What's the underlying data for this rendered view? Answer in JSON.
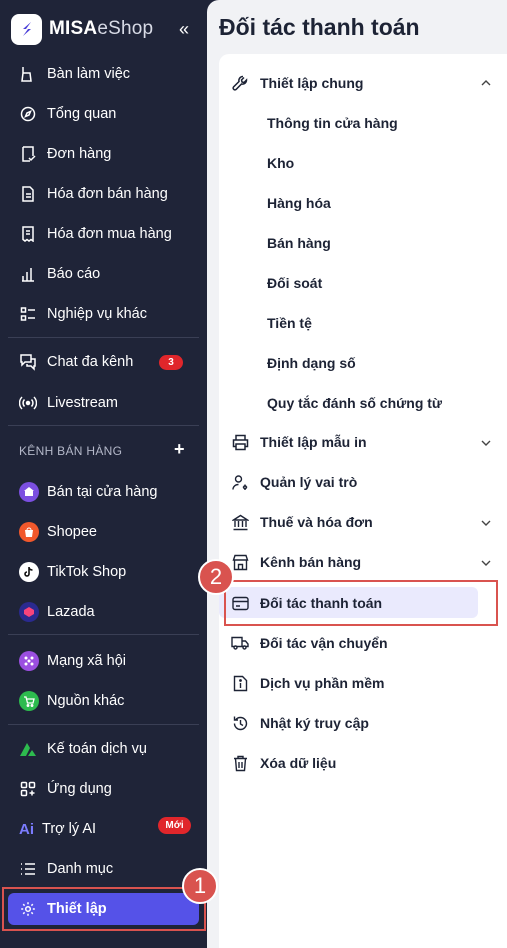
{
  "app": {
    "logo_bold": "MISA",
    "logo_light": "eShop",
    "collapse_icon": "«"
  },
  "sidebar": {
    "items": [
      {
        "label": "Bàn làm việc",
        "icon": "broom-icon"
      },
      {
        "label": "Tổng quan",
        "icon": "compass-icon"
      },
      {
        "label": "Đơn hàng",
        "icon": "order-icon"
      },
      {
        "label": "Hóa đơn bán hàng",
        "icon": "invoice-icon"
      },
      {
        "label": "Hóa đơn mua hàng",
        "icon": "receipt-icon"
      },
      {
        "label": "Báo cáo",
        "icon": "bar-chart-icon"
      },
      {
        "label": "Nghiệp vụ khác",
        "icon": "checklist-icon"
      },
      {
        "label": "Chat đa kênh",
        "icon": "chat-icon",
        "badge": "3"
      },
      {
        "label": "Livestream",
        "icon": "broadcast-icon"
      }
    ],
    "section_label": "KÊNH BÁN HÀNG",
    "plus": "+",
    "channels": [
      {
        "label": "Bán tại cửa hàng",
        "icon": "store-icon",
        "color": "#7b4fe0"
      },
      {
        "label": "Shopee",
        "icon": "shopee-icon",
        "color": "#f1582c"
      },
      {
        "label": "TikTok Shop",
        "icon": "tiktok-icon",
        "color": "#ffffff"
      },
      {
        "label": "Lazada",
        "icon": "lazada-icon",
        "color": "#2a2a8f"
      }
    ],
    "social": [
      {
        "label": "Mạng xã hội",
        "icon": "social-icon",
        "color": "#9b4fe0"
      },
      {
        "label": "Nguồn khác",
        "icon": "cart-icon",
        "color": "#2dbb4e"
      }
    ],
    "bottom": [
      {
        "label": "Kế toán dịch vụ",
        "icon": "accounting-icon"
      },
      {
        "label": "Ứng dụng",
        "icon": "apps-icon"
      },
      {
        "label": "Trợ lý AI",
        "icon": "ai-icon",
        "icon_text": "Ai",
        "badge": "Mới"
      },
      {
        "label": "Danh mục",
        "icon": "list-icon"
      }
    ],
    "active": {
      "label": "Thiết lập",
      "icon": "gear-icon"
    }
  },
  "main": {
    "title": "Đối tác thanh toán",
    "general": {
      "label": "Thiết lập chung",
      "subitems": [
        "Thông tin cửa hàng",
        "Kho",
        "Hàng hóa",
        "Bán hàng",
        "Đối soát",
        "Tiền tệ",
        "Định dạng số",
        "Quy tắc đánh số chứng từ"
      ]
    },
    "items": [
      {
        "label": "Thiết lập mẫu in",
        "icon": "printer-icon",
        "chevron": true
      },
      {
        "label": "Quản lý vai trò",
        "icon": "user-gear-icon",
        "chevron": false
      },
      {
        "label": "Thuế và hóa đơn",
        "icon": "bank-icon",
        "chevron": true
      },
      {
        "label": "Kênh bán hàng",
        "icon": "shop-icon",
        "chevron": true
      },
      {
        "label": "Đối tác thanh toán",
        "icon": "card-icon",
        "chevron": false
      },
      {
        "label": "Đối tác vận chuyển",
        "icon": "truck-icon",
        "chevron": false
      },
      {
        "label": "Dịch vụ phần mềm",
        "icon": "info-doc-icon",
        "chevron": false
      },
      {
        "label": "Nhật ký truy cập",
        "icon": "history-icon",
        "chevron": false
      },
      {
        "label": "Xóa dữ liệu",
        "icon": "trash-icon",
        "chevron": false
      }
    ]
  },
  "callouts": {
    "step1": "1",
    "step2": "2"
  },
  "colors": {
    "sidebar_bg": "#1f2438",
    "accent": "#5552e8",
    "highlight": "#d9534f"
  }
}
